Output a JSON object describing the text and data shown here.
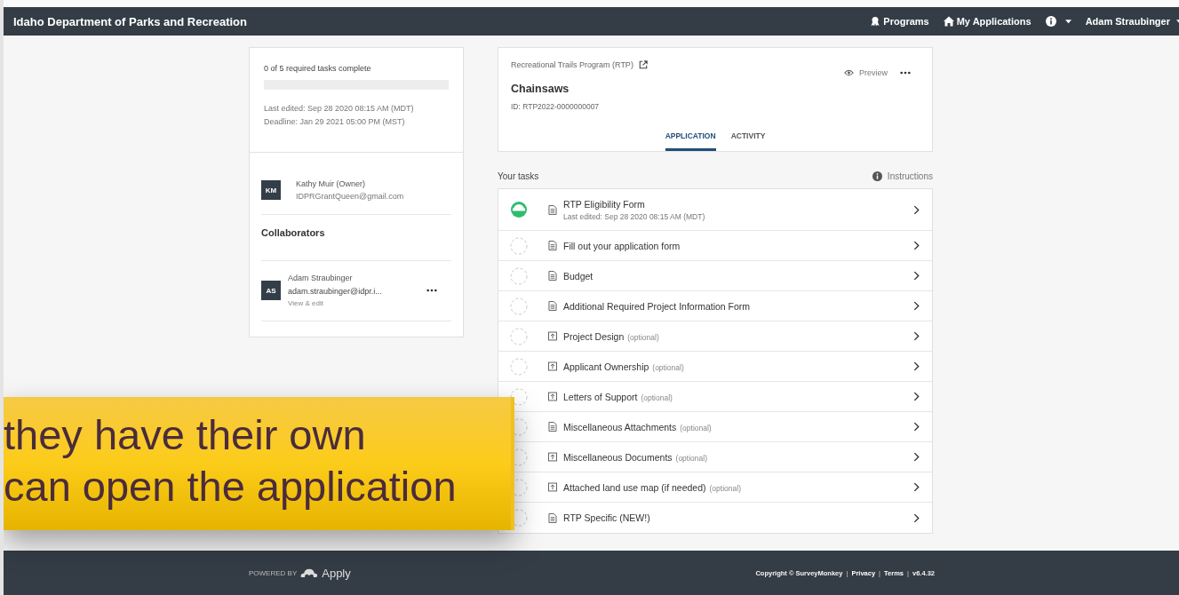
{
  "header": {
    "title": "Idaho Department of Parks and Recreation",
    "nav": [
      {
        "kind": "programs",
        "label": "Programs"
      },
      {
        "kind": "home",
        "label": "My Applications"
      },
      {
        "kind": "info"
      },
      {
        "kind": "user",
        "label": "Adam Straubinger"
      }
    ]
  },
  "summary": {
    "progress_text": "0 of 5 required tasks complete",
    "level": 0,
    "last_edited": "Last edited: Sep 28 2020 08:15 AM (MDT)",
    "deadline": "Deadline: Jan 29 2021 05:00 PM (MST)"
  },
  "owner": {
    "initials": "KM",
    "name": "Kathy Muir (Owner)",
    "email": "IDPRGrantQueen@gmail.com"
  },
  "collaborators": {
    "heading": "Collaborators",
    "people": [
      {
        "initials": "AS",
        "name": "Adam Straubinger",
        "email": "adam.straubinger@idpr.i...",
        "role": "View & edit"
      }
    ]
  },
  "application": {
    "program": "Recreational Trails Program (RTP)",
    "title": "Chainsaws",
    "id": "ID: RTP2022-0000000007",
    "preview": "Preview",
    "tabs": [
      {
        "label": "APPLICATION",
        "selected": true
      },
      {
        "label": "ACTIVITY",
        "selected": false
      }
    ]
  },
  "tasks": {
    "heading": "Your tasks",
    "instructions": "Instructions",
    "items": [
      {
        "title": "RTP Eligibility Form",
        "kind": "form",
        "started": true,
        "last_edited": "Last edited: Sep 28 2020 08:15 AM (MDT)"
      },
      {
        "title": "Fill out your application form",
        "kind": "form",
        "started": false
      },
      {
        "title": "Budget",
        "kind": "form",
        "started": false
      },
      {
        "title": "Additional Required Project Information Form",
        "kind": "form",
        "started": false
      },
      {
        "title": "Project Design",
        "kind": "upload",
        "started": false,
        "optional": "(optional)"
      },
      {
        "title": "Applicant Ownership",
        "kind": "upload",
        "started": false,
        "optional": "(optional)"
      },
      {
        "title": "Letters of Support",
        "kind": "upload",
        "started": false,
        "optional": "(optional)"
      },
      {
        "title": "Miscellaneous Attachments",
        "kind": "form",
        "started": false,
        "optional": "(optional)"
      },
      {
        "title": "Miscellaneous Documents",
        "kind": "upload",
        "started": false,
        "optional": "(optional)"
      },
      {
        "title": "Attached land use map (if needed)",
        "kind": "upload",
        "started": false,
        "optional": "(optional)"
      },
      {
        "title": "RTP Specific (NEW!)",
        "kind": "form",
        "started": false
      }
    ]
  },
  "footer": {
    "powered_by": "POWERED BY",
    "brand": "Apply",
    "items": [
      {
        "kind": "text",
        "text": "Copyright © SurveyMonkey"
      },
      {
        "kind": "separator",
        "text": "|"
      },
      {
        "kind": "link",
        "text": "Privacy"
      },
      {
        "kind": "separator",
        "text": "|"
      },
      {
        "kind": "link",
        "text": "Terms"
      },
      {
        "kind": "separator",
        "text": "|"
      },
      {
        "kind": "text",
        "text": "v6.4.32"
      }
    ]
  },
  "caption": {
    "lines": [
      "they have their own",
      "can open the application"
    ]
  }
}
